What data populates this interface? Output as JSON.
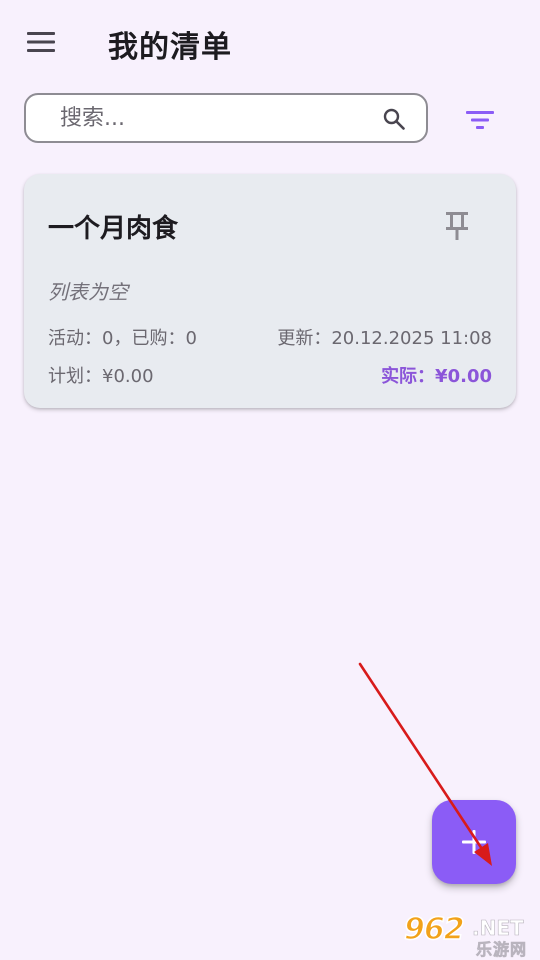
{
  "header": {
    "title": "我的清单",
    "menu_icon": "menu-icon"
  },
  "search": {
    "placeholder": "搜索...",
    "value": "",
    "search_icon": "search-icon",
    "filter_icon": "filter-icon"
  },
  "lists": [
    {
      "title": "一个月肉食",
      "pin_icon": "pin-icon",
      "empty_text": "列表为空",
      "stats_text": "活动：0，已购：0",
      "updated_text": "更新：20.12.2025 11:08",
      "planned_text": "计划：¥0.00",
      "actual_text": "实际：¥0.00"
    }
  ],
  "fab": {
    "icon": "plus-icon"
  },
  "colors": {
    "background": "#f8f1fd",
    "card": "#e8ebf0",
    "accent": "#8b5cf6",
    "actual_text": "#8b55d9",
    "annotation_arrow": "#d81b1b"
  },
  "watermark": {
    "number": "962",
    "domain": ".NET",
    "site": "乐游网"
  }
}
